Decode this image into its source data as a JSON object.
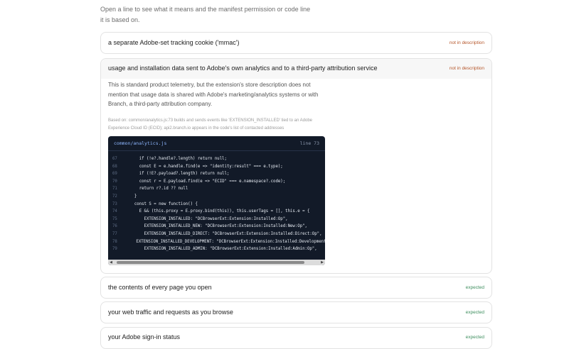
{
  "intro": {
    "text": "Open a line to see what it means and the manifest permission or code line it is based on."
  },
  "items": [
    {
      "title": "a separate Adobe-set tracking cookie ('mmac')",
      "badge": "not in description"
    },
    {
      "title": "usage and installation data sent to Adobe's own analytics and to a third-party attribution service",
      "badge": "not in description",
      "explanation": "This is standard product telemetry, but the extension's store description does not mention that usage data is shared with Adobe's marketing/analytics systems or with Branch, a third-party attribution company.",
      "basis": "Based on: common/analytics.js:73 builds and sends events like 'EXTENSION_INSTALLED' tied to an Adobe Experience Cloud ID (ECID); api2.branch.io appears in the code's list of contacted addresses",
      "code": {
        "file": "common/analytics.js",
        "line_label": "line 73",
        "lines": [
          {
            "n": "67",
            "text": "    if (!e?.handle?.length) return null;"
          },
          {
            "n": "68",
            "text": "    const E = e.handle.find(e => \"identity:result\" === e.type);"
          },
          {
            "n": "69",
            "text": "    if (!E?.payload?.length) return null;"
          },
          {
            "n": "70",
            "text": "    const r = E.payload.find(e => \"ECID\" === e.namespace?.code);"
          },
          {
            "n": "71",
            "text": "    return r?.id ?? null"
          },
          {
            "n": "72",
            "text": "  }"
          },
          {
            "n": "73",
            "text": "  const S = new function() {"
          },
          {
            "n": "74",
            "text": "    E && (this.proxy = E.proxy.bind(this)), this.userTags = [], this.e = {"
          },
          {
            "n": "75",
            "text": "      EXTENSION_INSTALLED: \"DCBrowserExt:Extension:Installed:Op\","
          },
          {
            "n": "76",
            "text": "      EXTENSION_INSTALLED_NEW: \"DCBrowserExt:Extension:Installed:New:Op\","
          },
          {
            "n": "77",
            "text": "      EXTENSION_INSTALLED_DIRECT: \"DCBrowserExt:Extension:Installed:Direct:Op\","
          },
          {
            "n": "78",
            "text": "      EXTENSION_INSTALLED_DEVELOPMENT: \"DCBrowserExt:Extension:Installed:Development"
          },
          {
            "n": "79",
            "text": "      EXTENSION_INSTALLED_ADMIN: \"DCBrowserExt:Extension:Installed:Admin:Op\","
          }
        ]
      }
    },
    {
      "title": "the contents of every page you open",
      "badge": "expected"
    },
    {
      "title": "your web traffic and requests as you browse",
      "badge": "expected"
    },
    {
      "title": "your Adobe sign-in status",
      "badge": "expected"
    }
  ],
  "colors": {
    "warn_badge": "#b5562a",
    "ok_badge": "#3f8f5f",
    "code_bg": "#121a28"
  }
}
